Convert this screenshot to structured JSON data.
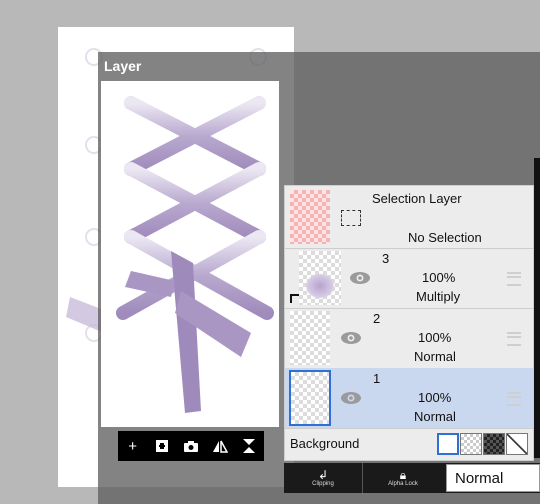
{
  "panel": {
    "title": "Layer"
  },
  "toolbar": {
    "add_label": "+",
    "add_icon": "add-layer-icon",
    "copy_icon": "duplicate-layer-icon",
    "camera_icon": "camera-icon",
    "flip_icon": "flip-icon",
    "merge_icon": "merge-down-icon"
  },
  "selection_layer": {
    "title": "Selection Layer",
    "status": "No Selection"
  },
  "layers": [
    {
      "number": "3",
      "opacity": "100%",
      "blend": "Multiply"
    },
    {
      "number": "2",
      "opacity": "100%",
      "blend": "Normal"
    },
    {
      "number": "1",
      "opacity": "100%",
      "blend": "Normal"
    }
  ],
  "background": {
    "label": "Background"
  },
  "bottom": {
    "clipping": "Clipping",
    "alpha_lock": "Alpha Lock",
    "blend_mode": "Normal"
  },
  "colors": {
    "selected_row": "#c9d8ee",
    "accent": "#2f6fd6",
    "lace": "#a794bf"
  }
}
